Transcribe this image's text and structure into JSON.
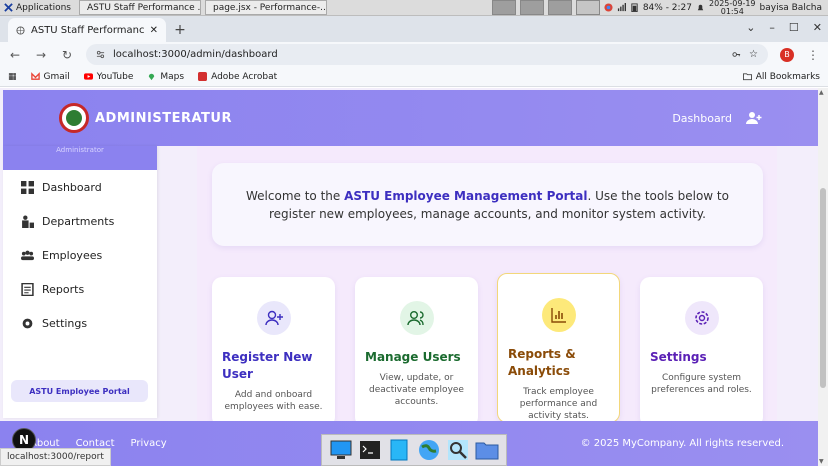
{
  "os": {
    "app_menu": "Applications",
    "tasks": [
      "ASTU Staff Performance ...",
      "page.jsx - Performance-..."
    ],
    "battery": "84% - 2:27",
    "date": "2025-09-19",
    "time": "01:54",
    "user": "bayisa Balcha"
  },
  "browser": {
    "tab_title": "ASTU Staff Performance E",
    "url": "localhost:3000/admin/dashboard",
    "profile_initial": "B",
    "bookmarks": [
      "Gmail",
      "YouTube",
      "Maps",
      "Adobe Acrobat"
    ],
    "all_bookmarks": "All Bookmarks",
    "status_url": "localhost:3000/report"
  },
  "topnav": {
    "brand": "ADMINISTERATUR",
    "dashboard_link": "Dashboard"
  },
  "sidebar": {
    "head_text": "Administrator",
    "items": [
      {
        "label": "Dashboard"
      },
      {
        "label": "Departments"
      },
      {
        "label": "Employees"
      },
      {
        "label": "Reports"
      },
      {
        "label": "Settings"
      }
    ],
    "footer": "ASTU Employee Portal"
  },
  "welcome": {
    "prefix": "Welcome to the ",
    "highlight": "ASTU Employee Management Portal",
    "suffix": ". Use the tools below to register new employees, manage accounts, and monitor system activity."
  },
  "cards": [
    {
      "title": "Register New User",
      "desc": "Add and onboard employees with ease.",
      "color": "#3d2fc0",
      "icon_bg": "#e9e7fb"
    },
    {
      "title": "Manage Users",
      "desc": "View, update, or deactivate employee accounts.",
      "color": "#1b6b2f",
      "icon_bg": "#e2f5e6"
    },
    {
      "title": "Reports & Analytics",
      "desc": "Track employee performance and activity stats.",
      "color": "#8a4b08",
      "icon_bg": "#fde97a"
    },
    {
      "title": "Settings",
      "desc": "Configure system preferences and roles.",
      "color": "#5b21b6",
      "icon_bg": "#efe7fb"
    }
  ],
  "footer": {
    "links": [
      "About",
      "Contact",
      "Privacy"
    ],
    "copyright": "© 2025 MyCompany. All rights reserved."
  },
  "badge": "N"
}
